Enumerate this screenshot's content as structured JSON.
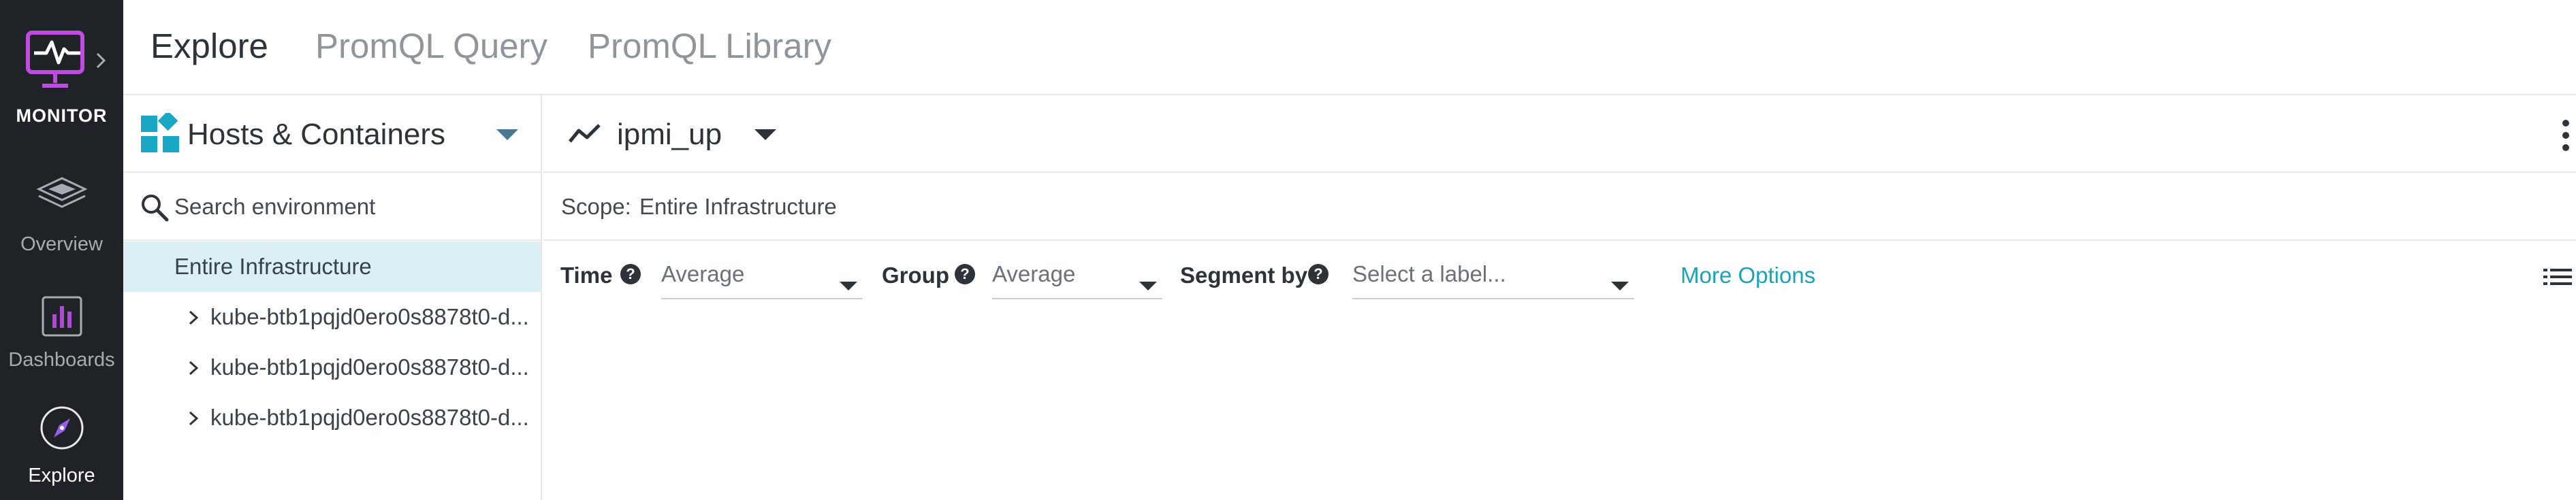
{
  "app": {
    "brand_label": "MONITOR",
    "nav": [
      {
        "label": "Overview",
        "icon": "layers-icon"
      },
      {
        "label": "Dashboards",
        "icon": "dashboard-chart-icon"
      },
      {
        "label": "Explore",
        "icon": "compass-icon"
      }
    ]
  },
  "tabs": [
    {
      "label": "Explore",
      "active": true
    },
    {
      "label": "PromQL Query",
      "active": false
    },
    {
      "label": "PromQL Library",
      "active": false
    }
  ],
  "environment": {
    "title": "Hosts & Containers",
    "search_placeholder": "Search environment",
    "root_label": "Entire Infrastructure",
    "nodes": [
      "kube-btb1pqjd0ero0s8878t0-d...",
      "kube-btb1pqjd0ero0s8878t0-d...",
      "kube-btb1pqjd0ero0s8878t0-d..."
    ]
  },
  "metric": {
    "name": "ipmi_up",
    "scope_label": "Scope:",
    "scope_value": "Entire Infrastructure"
  },
  "controls": {
    "time_label": "Time",
    "time_value": "Average",
    "group_label": "Group",
    "group_value": "Average",
    "segment_label": "Segment by",
    "segment_placeholder": "Select a label...",
    "more_options": "More Options"
  },
  "colors": {
    "nav_bg": "#1f2328",
    "brand_accent": "#c04be0",
    "selected_row": "#daf0f4",
    "link": "#1aa4b8",
    "tiles": "#18a7c4"
  }
}
